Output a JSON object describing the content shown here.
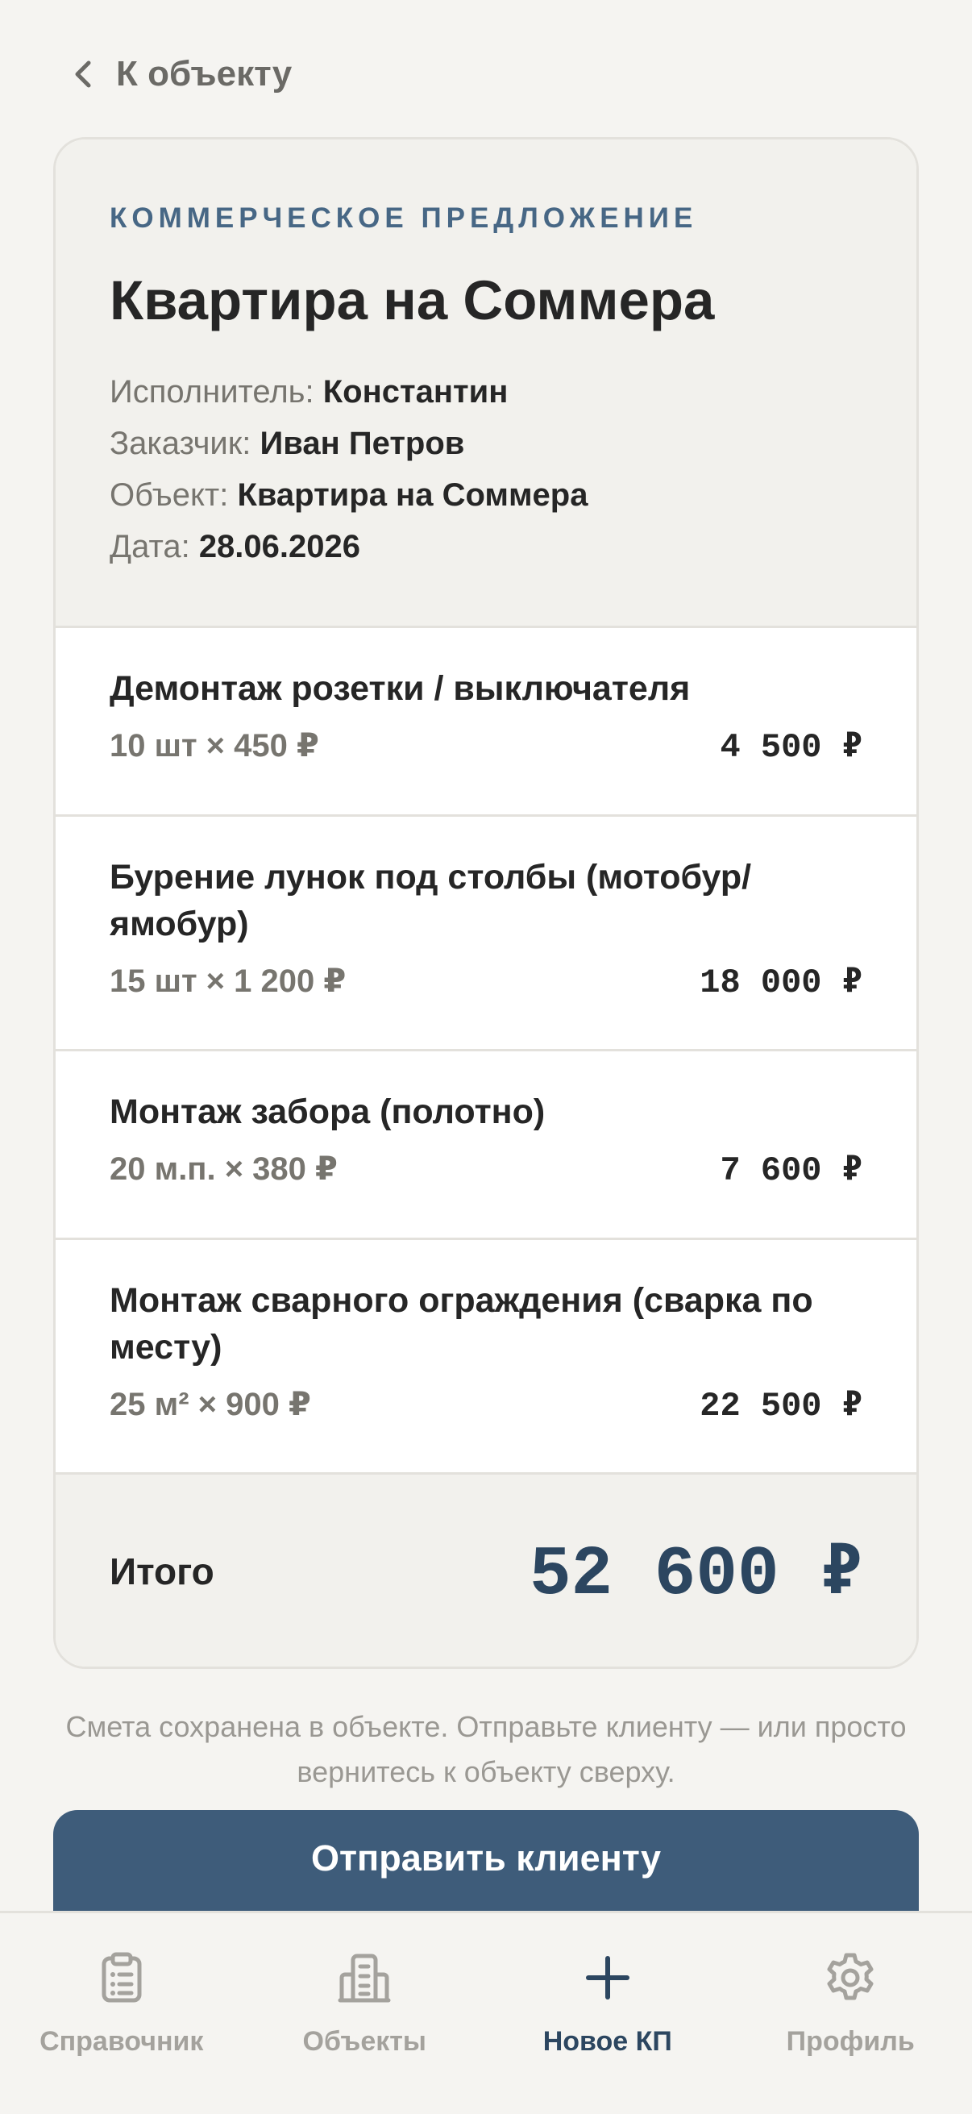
{
  "nav": {
    "back_label": "К объекту"
  },
  "proposal": {
    "eyebrow": "КОММЕРЧЕСКОЕ ПРЕДЛОЖЕНИЕ",
    "title": "Квартира на Соммера",
    "meta": [
      {
        "key": "Исполнитель:",
        "value": "Константин"
      },
      {
        "key": "Заказчик:",
        "value": "Иван Петров"
      },
      {
        "key": "Объект:",
        "value": "Квартира на Соммера"
      },
      {
        "key": "Дата:",
        "value": "28.06.2026"
      }
    ],
    "items": [
      {
        "title": "Демонтаж розетки / выключателя",
        "qty": "10 шт × 450 ₽",
        "sum": "4 500 ₽"
      },
      {
        "title": "Бурение лунок под столбы (мотобур/ ямобур)",
        "qty": "15 шт × 1 200 ₽",
        "sum": "18 000 ₽"
      },
      {
        "title": "Монтаж забора (полотно)",
        "qty": "20 м.п. × 380 ₽",
        "sum": "7 600 ₽"
      },
      {
        "title": "Монтаж сварного ограждения (сварка по месту)",
        "qty": "25 м² × 900 ₽",
        "sum": "22 500 ₽"
      }
    ],
    "total_label": "Итого",
    "total_sum": "52 600 ₽"
  },
  "note": "Смета сохранена в объекте. Отправьте клиенту — или просто вернитесь к объекту сверху.",
  "cta_label": "Отправить клиенту",
  "tabbar": [
    {
      "label": "Справочник",
      "icon": "clipboard-icon"
    },
    {
      "label": "Объекты",
      "icon": "building-icon"
    },
    {
      "label": "Новое КП",
      "icon": "plus-icon",
      "active": true
    },
    {
      "label": "Профиль",
      "icon": "gear-icon"
    }
  ],
  "colors": {
    "accent": "#3e5c7a",
    "accent_dark": "#2c4660",
    "eyebrow": "#476785",
    "background": "#f5f4f1"
  }
}
